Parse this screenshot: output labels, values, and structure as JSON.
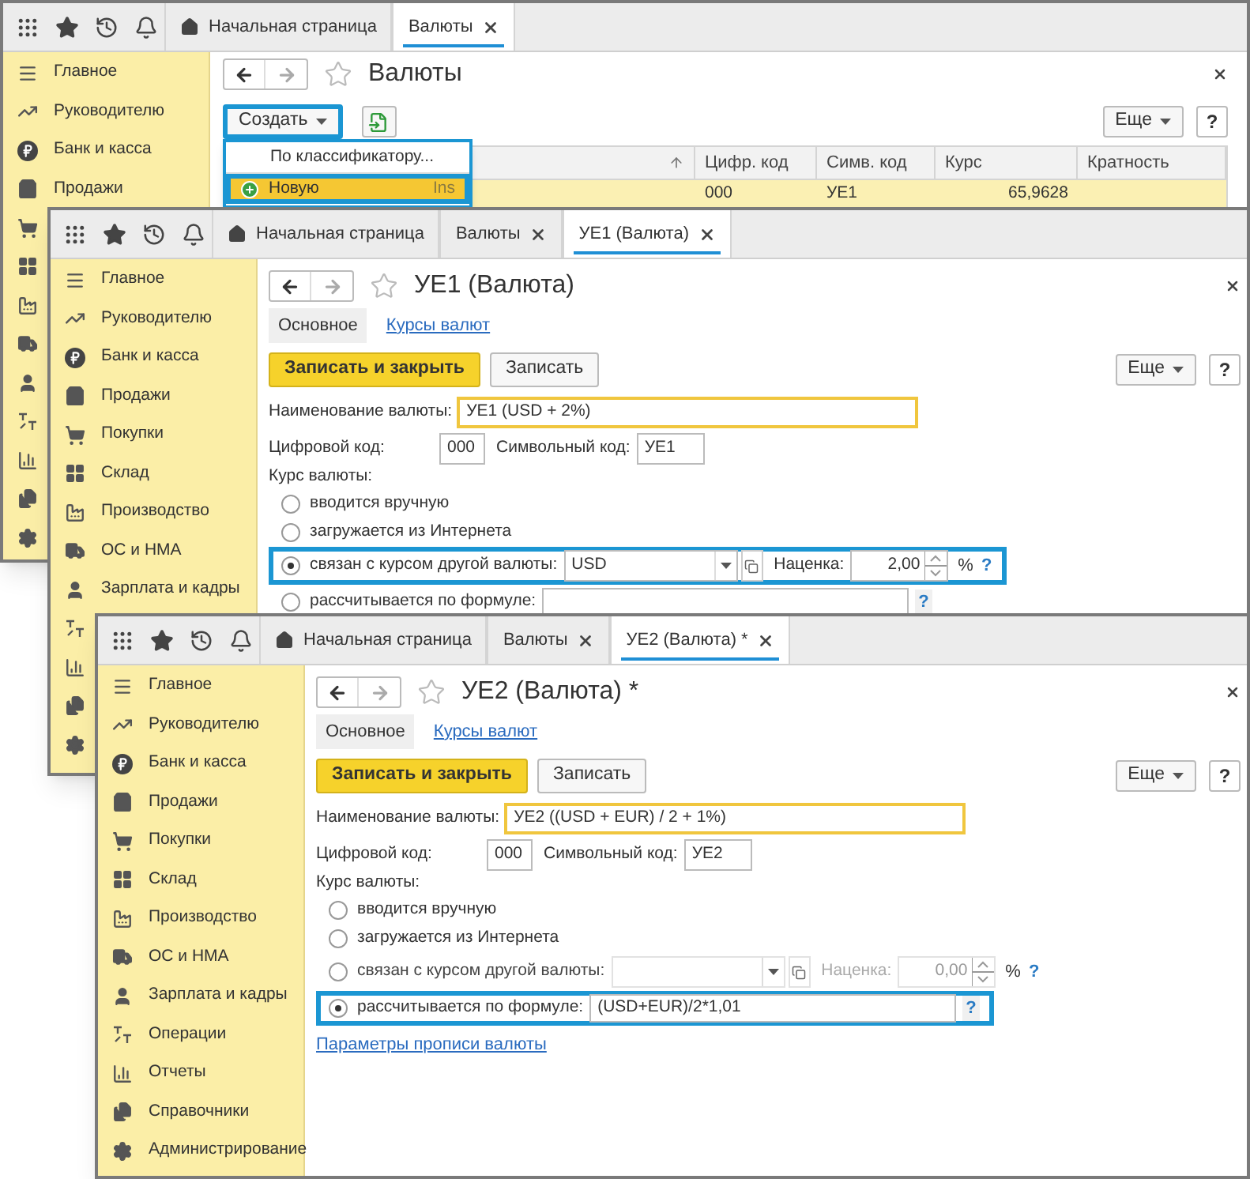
{
  "windows": [
    {
      "kind": "list",
      "top_tabs": [
        {
          "label": "Начальная страница",
          "kind": "home",
          "selected": false
        },
        {
          "label": "Валюты",
          "kind": "page",
          "selected": true
        }
      ],
      "sidebar": [
        {
          "kind": "labeled",
          "label": "Главное"
        },
        {
          "kind": "labeled",
          "label": "Руководителю"
        },
        {
          "kind": "labeled",
          "label": "Банк и касса"
        },
        {
          "kind": "labeled",
          "label": "Продажи"
        },
        {
          "kind": "icon_only"
        },
        {
          "kind": "icon_only"
        },
        {
          "kind": "icon_only"
        },
        {
          "kind": "icon_only"
        },
        {
          "kind": "icon_only"
        },
        {
          "kind": "icon_only"
        },
        {
          "kind": "icon_only"
        },
        {
          "kind": "icon_only"
        },
        {
          "kind": "icon_only"
        }
      ],
      "title": "Валюты",
      "create_button": {
        "label": "Создать",
        "highlighted": true
      },
      "more_button": "Еще",
      "help_button": "?",
      "columns": [
        "Цифр. код",
        "Симв. код",
        "Курс",
        "Кратность"
      ],
      "rows": [
        {
          "selected": true,
          "cells": [
            "000",
            "УЕ1",
            "65,9628"
          ]
        }
      ],
      "menu": [
        {
          "label": "По классификатору...",
          "selected": false
        },
        {
          "label": "Новую",
          "shortcut": "Ins",
          "selected": true
        }
      ]
    },
    {
      "kind": "currency_form",
      "top_tabs": [
        {
          "label": "Начальная страница",
          "kind": "home",
          "selected": false
        },
        {
          "label": "Валюты",
          "kind": "page",
          "selected": false
        },
        {
          "label": "УЕ1 (Валюта)",
          "kind": "page",
          "selected": true
        }
      ],
      "sidebar": [
        {
          "kind": "labeled",
          "label": "Главное"
        },
        {
          "kind": "labeled",
          "label": "Руководителю"
        },
        {
          "kind": "labeled",
          "label": "Банк и касса"
        },
        {
          "kind": "labeled",
          "label": "Продажи"
        },
        {
          "kind": "labeled",
          "label": "Покупки"
        },
        {
          "kind": "labeled",
          "label": "Склад"
        },
        {
          "kind": "labeled",
          "label": "Производство"
        },
        {
          "kind": "labeled",
          "label": "ОС и НМА"
        },
        {
          "kind": "labeled",
          "label": "Зарплата и кадры"
        },
        {
          "kind": "icon_only"
        },
        {
          "kind": "icon_only"
        },
        {
          "kind": "icon_only"
        },
        {
          "kind": "icon_only"
        }
      ],
      "title": "УЕ1 (Валюта)",
      "sections": [
        {
          "label": "Основное",
          "selected": true
        },
        {
          "label": "Курсы валют",
          "selected": false
        }
      ],
      "save_close_button": "Записать и закрыть",
      "save_button": "Записать",
      "more_button": "Еще",
      "help_button": "?",
      "name_label": "Наименование валюты:",
      "name_value": "УЕ1 (USD + 2%)",
      "digital_label": "Цифровой код:",
      "digital_value": "000",
      "symbol_label": "Символьный код:",
      "symbol_value": "УЕ1",
      "rate_label": "Курс валюты:",
      "rate_options": [
        {
          "kind": "plain",
          "label": "вводится вручную",
          "selected": false,
          "highlighted": false
        },
        {
          "kind": "plain",
          "label": "загружается из Интернета",
          "selected": false,
          "highlighted": false
        },
        {
          "kind": "linked",
          "label": "связан с курсом другой валюты:",
          "selected": true,
          "highlighted": true,
          "disabled": false,
          "base_currency": "USD",
          "markup_label": "Наценка:",
          "markup_value": "2,00",
          "percent": "%",
          "help": "?"
        },
        {
          "kind": "formula",
          "label": "рассчитывается по формуле:",
          "selected": false,
          "highlighted": false,
          "help": "?"
        }
      ]
    },
    {
      "kind": "currency_form",
      "top_tabs": [
        {
          "label": "Начальная страница",
          "kind": "home",
          "selected": false
        },
        {
          "label": "Валюты",
          "kind": "page",
          "selected": false
        },
        {
          "label": "УЕ2 (Валюта) *",
          "kind": "page",
          "selected": true
        }
      ],
      "sidebar": [
        {
          "kind": "labeled",
          "label": "Главное"
        },
        {
          "kind": "labeled",
          "label": "Руководителю"
        },
        {
          "kind": "labeled",
          "label": "Банк и касса"
        },
        {
          "kind": "labeled",
          "label": "Продажи"
        },
        {
          "kind": "labeled",
          "label": "Покупки"
        },
        {
          "kind": "labeled",
          "label": "Склад"
        },
        {
          "kind": "labeled",
          "label": "Производство"
        },
        {
          "kind": "labeled",
          "label": "ОС и НМА"
        },
        {
          "kind": "labeled",
          "label": "Зарплата и кадры"
        },
        {
          "kind": "labeled",
          "label": "Операции"
        },
        {
          "kind": "labeled",
          "label": "Отчеты"
        },
        {
          "kind": "labeled",
          "label": "Справочники"
        },
        {
          "kind": "labeled",
          "label": "Администрирование"
        }
      ],
      "title": "УЕ2 (Валюта) *",
      "sections": [
        {
          "label": "Основное",
          "selected": true
        },
        {
          "label": "Курсы валют",
          "selected": false
        }
      ],
      "save_close_button": "Записать и закрыть",
      "save_button": "Записать",
      "more_button": "Еще",
      "help_button": "?",
      "name_label": "Наименование валюты:",
      "name_value": "УЕ2 ((USD + EUR) / 2 + 1%)",
      "digital_label": "Цифровой код:",
      "digital_value": "000",
      "symbol_label": "Символьный код:",
      "symbol_value": "УЕ2",
      "rate_label": "Курс валюты:",
      "rate_options": [
        {
          "kind": "plain",
          "label": "вводится вручную",
          "selected": false,
          "highlighted": false
        },
        {
          "kind": "plain",
          "label": "загружается из Интернета",
          "selected": false,
          "highlighted": false
        },
        {
          "kind": "linked",
          "label": "связан с курсом другой валюты:",
          "selected": false,
          "highlighted": false,
          "disabled": true,
          "markup_label": "Наценка:",
          "markup_value": "0,00",
          "percent": "%",
          "help": "?"
        },
        {
          "kind": "formula",
          "label": "рассчитывается по формуле:",
          "selected": true,
          "highlighted": true,
          "formula": "(USD+EUR)/2*1,01",
          "help": "?"
        }
      ],
      "link": "Параметры прописи валюты"
    }
  ]
}
